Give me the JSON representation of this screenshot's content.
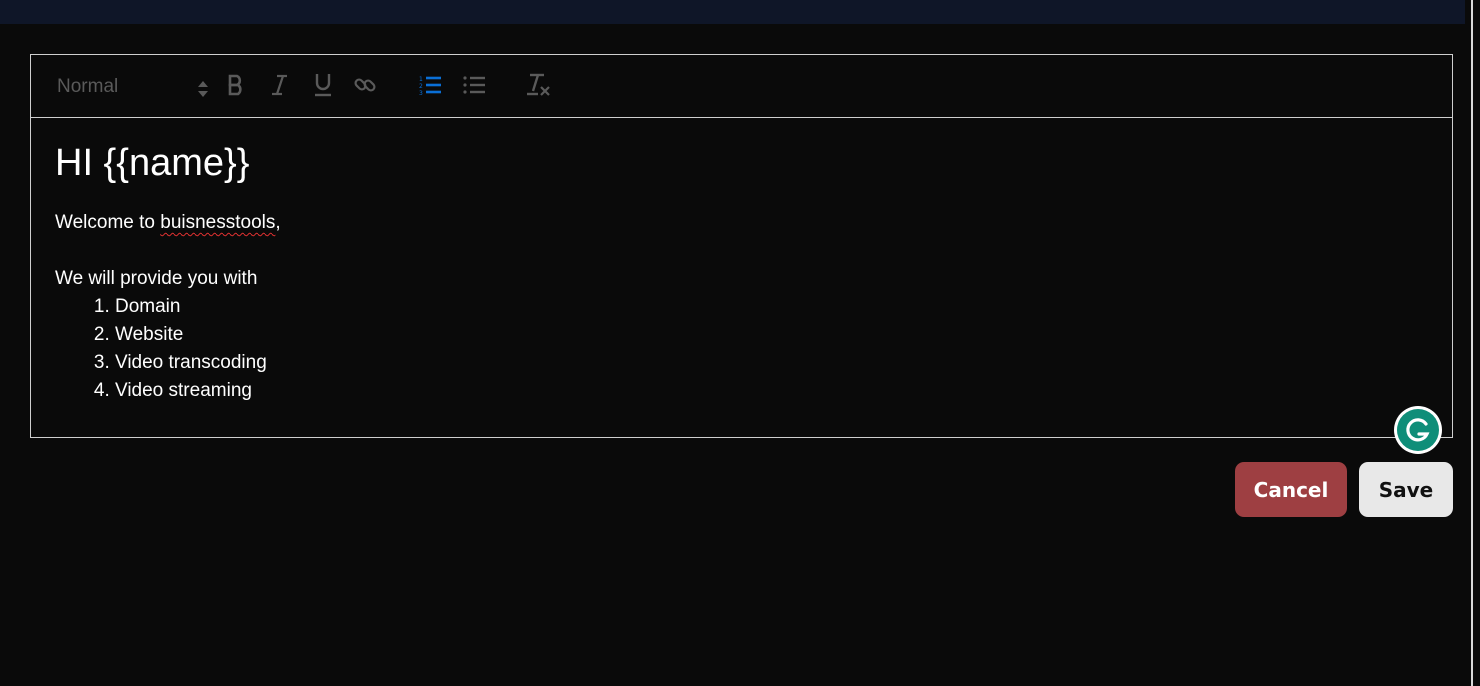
{
  "toolbar": {
    "header_picker": {
      "value": "Normal"
    },
    "buttons": [
      {
        "name": "bold",
        "icon": "bold-icon"
      },
      {
        "name": "italic",
        "icon": "italic-icon"
      },
      {
        "name": "underline",
        "icon": "underline-icon"
      },
      {
        "name": "link",
        "icon": "link-icon"
      },
      {
        "name": "ordered-list",
        "icon": "ordered-list-icon",
        "active": true
      },
      {
        "name": "bullet-list",
        "icon": "bullet-list-icon"
      },
      {
        "name": "clear-format",
        "icon": "clear-format-icon"
      }
    ],
    "active_color": "#0a6fd6",
    "icon_color": "#5a5a5a"
  },
  "content": {
    "heading": "HI {{name}}",
    "welcome_prefix": "Welcome to ",
    "welcome_word": "buisnesstools",
    "welcome_suffix": ",",
    "intro": "We will provide you with",
    "list": [
      "Domain",
      "Website",
      "Video transcoding",
      "Video streaming"
    ]
  },
  "grammarly": {
    "icon": "grammarly-icon",
    "color": "#0f8e79"
  },
  "actions": {
    "cancel_label": "Cancel",
    "save_label": "Save",
    "cancel_color": "#9e3f42",
    "save_color": "#e8e8e8"
  }
}
